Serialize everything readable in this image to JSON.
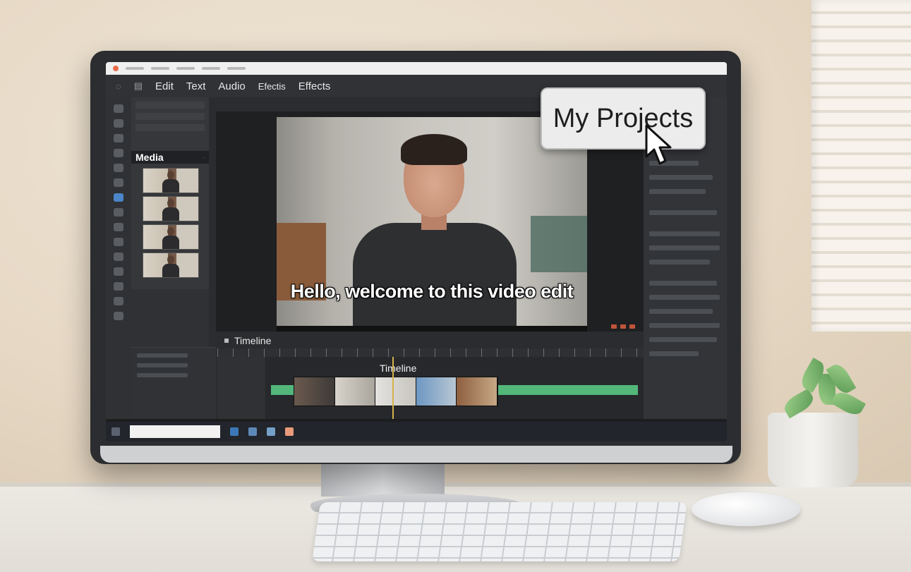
{
  "menu": {
    "items": [
      "Edit",
      "Text",
      "Audio",
      "Efectis",
      "Effects"
    ]
  },
  "media_panel": {
    "title": "Media",
    "thumbnails": [
      "clip-1",
      "clip-2",
      "clip-3",
      "clip-4"
    ]
  },
  "preview": {
    "caption": "Hello, welcome to this video edit"
  },
  "projects_button": {
    "label": "My Projects"
  },
  "timeline": {
    "header": "Timeline",
    "track_label": "Timeline"
  },
  "colors": {
    "accent_green": "#53b77a",
    "playhead": "#d6b14c",
    "active_tool": "#4a86c8"
  },
  "icons": [
    "pointer-cursor-icon",
    "menu-icon",
    "tool-icons"
  ]
}
